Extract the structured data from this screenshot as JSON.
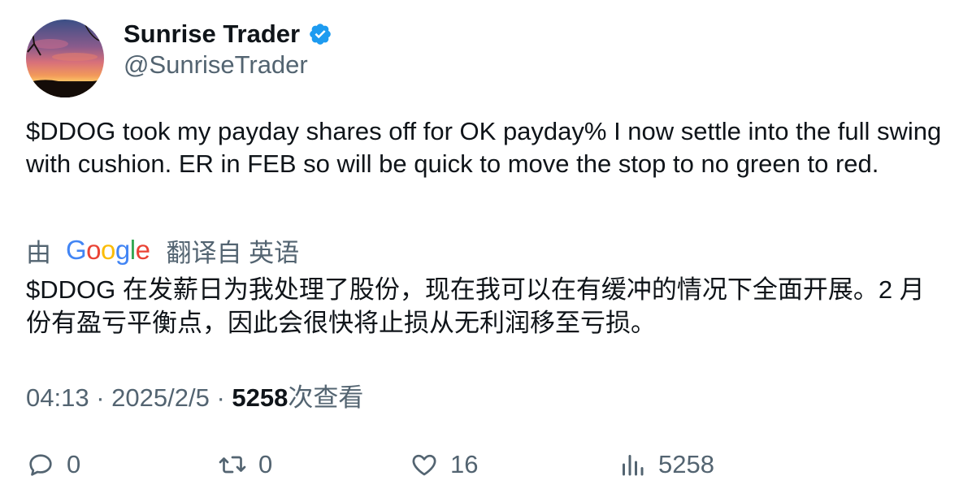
{
  "author": {
    "display_name": "Sunrise Trader",
    "handle": "@SunriseTrader",
    "verified": true,
    "verified_color": "#1d9bf0"
  },
  "tweet": {
    "text": "$DDOG took my payday shares off for OK payday% I now settle into the full swing with cushion. ER in FEB so will be quick to move the stop to no green to red."
  },
  "translation": {
    "prefix": "由",
    "provider": "Google",
    "provider_letters": [
      {
        "char": "G",
        "color": "#4285F4"
      },
      {
        "char": "o",
        "color": "#EA4335"
      },
      {
        "char": "o",
        "color": "#FBBC05"
      },
      {
        "char": "g",
        "color": "#4285F4"
      },
      {
        "char": "l",
        "color": "#34A853"
      },
      {
        "char": "e",
        "color": "#EA4335"
      }
    ],
    "suffix": "翻译自 英语",
    "text": "$DDOG 在发薪日为我处理了股份，现在我可以在有缓冲的情况下全面开展。2 月份有盈亏平衡点，因此会很快将止损从无利润移至亏损。"
  },
  "meta": {
    "time": "04:13",
    "separator": "·",
    "date": "2025/2/5",
    "views_count": "5258",
    "views_label": "次查看"
  },
  "actions": {
    "reply_count": "0",
    "retweet_count": "0",
    "like_count": "16",
    "views_count": "5258"
  },
  "icons": {
    "reply": "reply-icon",
    "retweet": "retweet-icon",
    "like": "heart-icon",
    "views": "analytics-icon",
    "verified": "verified-badge-icon"
  },
  "colors": {
    "text_primary": "#0f1419",
    "text_secondary": "#536471"
  }
}
